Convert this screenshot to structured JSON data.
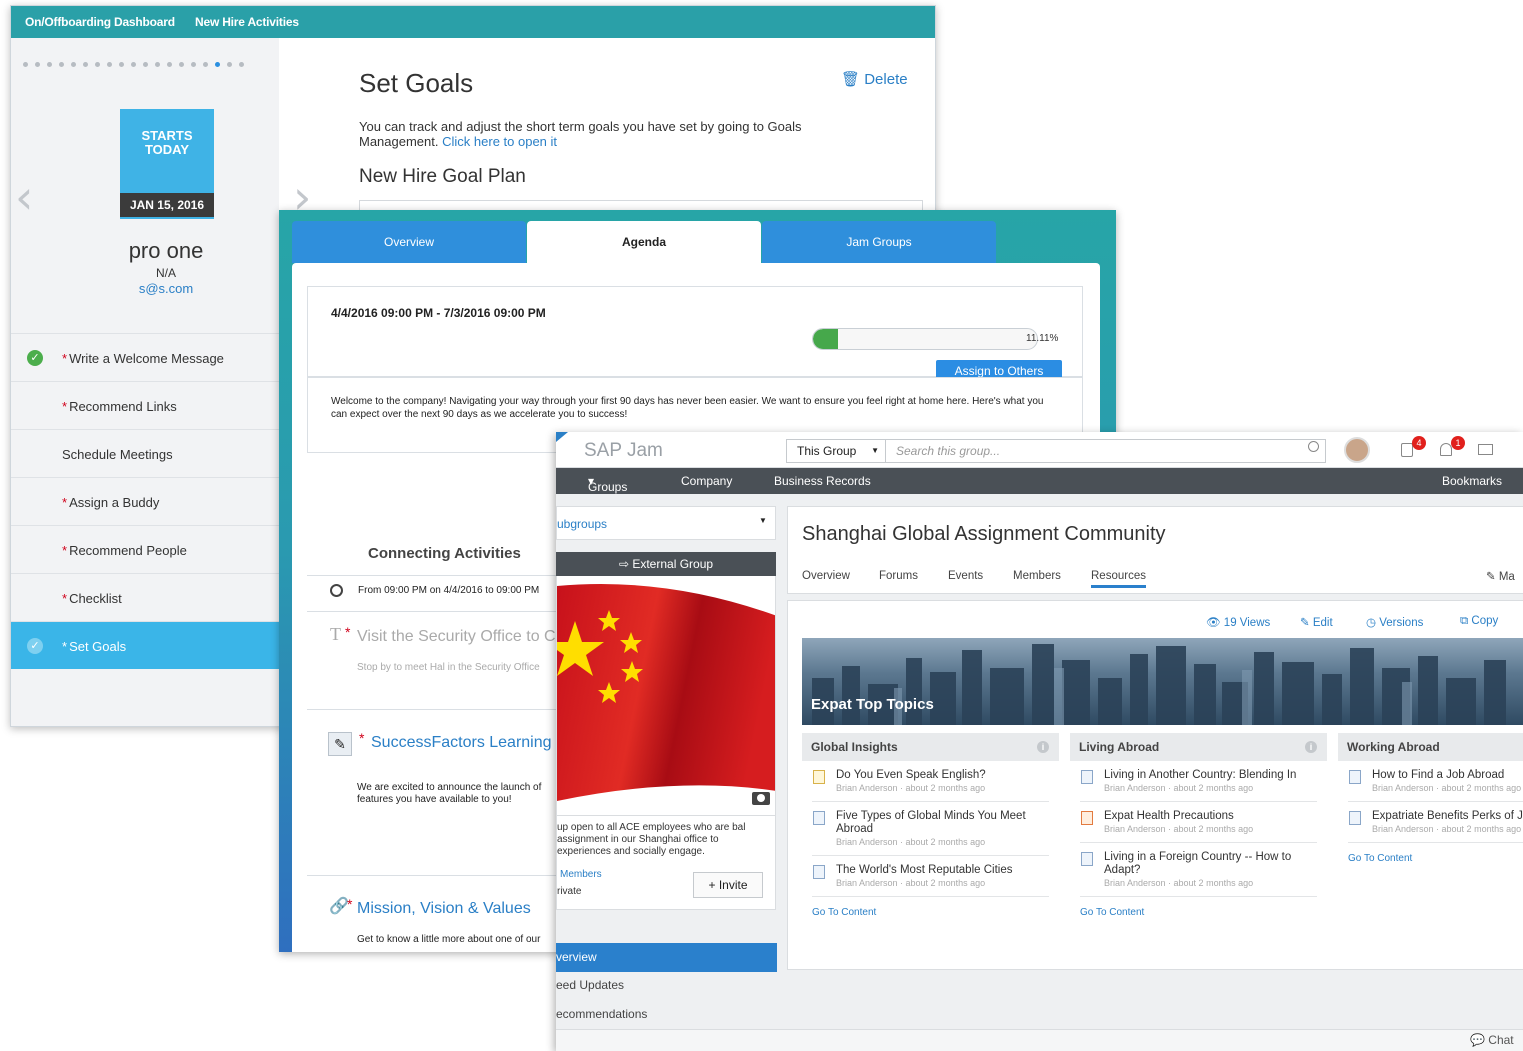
{
  "onboarding": {
    "nav": {
      "dashboard": "On/Offboarding Dashboard",
      "new_hire": "New Hire Activities"
    },
    "pager": {
      "count": 19,
      "active_index": 16
    },
    "starts": {
      "line1": "STARTS",
      "line2": "TODAY",
      "date": "JAN 15, 2016"
    },
    "person": {
      "name": "pro one",
      "title": "N/A",
      "email": "s@s.com"
    },
    "tasks": [
      {
        "label": "Write a Welcome Message",
        "required": true,
        "done": true
      },
      {
        "label": "Recommend Links",
        "required": true,
        "done": false
      },
      {
        "label": "Schedule Meetings",
        "required": false,
        "done": false
      },
      {
        "label": "Assign a Buddy",
        "required": true,
        "done": false
      },
      {
        "label": "Recommend People",
        "required": true,
        "done": false
      },
      {
        "label": "Checklist",
        "required": true,
        "done": false
      },
      {
        "label": "Set Goals",
        "required": true,
        "done": true,
        "selected": true
      }
    ],
    "goals": {
      "title": "Set Goals",
      "delete": "Delete",
      "desc": "You can track and adjust the short term goals you have set by going to Goals Management.",
      "link": "Click here to open it",
      "plan": "New Hire Goal Plan"
    }
  },
  "agenda": {
    "tabs": [
      "Overview",
      "Agenda",
      "Jam Groups"
    ],
    "active_tab": 1,
    "range": "4/4/2016 09:00 PM - 7/3/2016 09:00 PM",
    "progress": {
      "value": 11.11,
      "label": "11.11%"
    },
    "assign_button": "Assign to Others",
    "welcome": "Welcome to the company! Navigating your way through your first 90 days has never been easier. We want to ensure you feel right at home here. Here's what you can expect over the next 90 days as we accelerate you to success!",
    "section_title": "Connecting Activities",
    "time_line": "From 09:00 PM on 4/4/2016 to 09:00 PM",
    "activities": [
      {
        "title": "Visit the Security Office to C",
        "desc": "Stop by to meet Hal in the Security Office"
      },
      {
        "title": "SuccessFactors Learning",
        "desc": "We are excited to announce the launch of features you have available to you!"
      },
      {
        "title": "Mission, Vision & Values",
        "desc": "Get to know a little more about one of our"
      }
    ]
  },
  "jam": {
    "brand": "SAP Jam",
    "scope": "This Group",
    "search_placeholder": "Search this group...",
    "badges": {
      "tasks": "4",
      "alerts": "1"
    },
    "nav": {
      "groups": "Groups",
      "company": "Company",
      "records": "Business Records",
      "bookmarks": "Bookmarks"
    },
    "subgroups": "ubgroups",
    "external": "External Group",
    "group_desc": "up open to all ACE employees who are bal assignment in our Shanghai office to experiences and socially engage.",
    "members": "Members",
    "privacy": "rivate",
    "invite": "Invite",
    "left_nav": [
      "verview",
      "eed Updates",
      "ecommendations"
    ],
    "group_title": "Shanghai Global Assignment Community",
    "tabs": [
      "Overview",
      "Forums",
      "Events",
      "Members",
      "Resources"
    ],
    "active_tab": 4,
    "manage": "Ma",
    "actions": {
      "views": "19 Views",
      "edit": "Edit",
      "versions": "Versions",
      "copy": "Copy"
    },
    "banner": "Expat Top Topics",
    "columns": [
      {
        "title": "Global Insights",
        "items": [
          {
            "title": "Do You Even Speak English?",
            "meta": "Brian Anderson · about 2 months ago",
            "kind": "y"
          },
          {
            "title": "Five Types of Global Minds You Meet Abroad",
            "meta": "Brian Anderson · about 2 months ago",
            "kind": "b"
          },
          {
            "title": "The World's Most Reputable Cities",
            "meta": "Brian Anderson · about 2 months ago",
            "kind": "b"
          }
        ],
        "link": "Go To Content"
      },
      {
        "title": "Living Abroad",
        "items": [
          {
            "title": "Living in Another Country: Blending In",
            "meta": "Brian Anderson · about 2 months ago",
            "kind": "b"
          },
          {
            "title": "Expat Health Precautions",
            "meta": "Brian Anderson · about 2 months ago",
            "kind": "o"
          },
          {
            "title": "Living in a Foreign Country -- How to Adapt?",
            "meta": "Brian Anderson · about 2 months ago",
            "kind": "b"
          }
        ],
        "link": "Go To Content"
      },
      {
        "title": "Working Abroad",
        "items": [
          {
            "title": "How to Find a Job Abroad",
            "meta": "Brian Anderson · about 2 months ago",
            "kind": "b"
          },
          {
            "title": "Expatriate Benefits Perks of Job",
            "meta": "Brian Anderson · about 2 months ago",
            "kind": "b"
          }
        ],
        "link": "Go To Content"
      }
    ],
    "chat": "Chat"
  }
}
